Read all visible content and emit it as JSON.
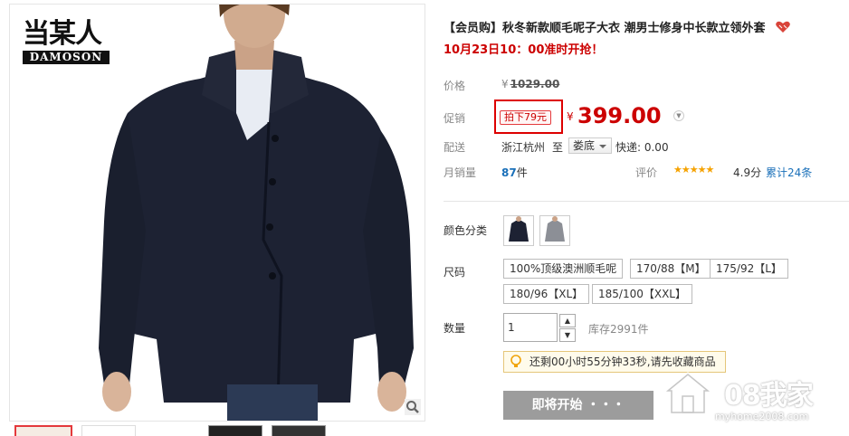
{
  "brand": {
    "logo_cn": "当某人",
    "logo_en": "DAMOSON"
  },
  "product": {
    "title": "【会员购】秋冬新款顺毛呢子大衣 潮男士修身中长款立领外套",
    "promo_time": "10月23日10：00准时开抢！"
  },
  "price": {
    "orig_label": "价格",
    "currency": "¥",
    "orig_value": "1029.00",
    "promo_label": "促销",
    "promo_tag": "拍下79元",
    "promo_value": "399.00"
  },
  "shipping": {
    "label": "配送",
    "from": "浙江杭州",
    "to_word": "至",
    "destination": "娄底",
    "fee": "快递: 0.00"
  },
  "sales": {
    "label": "月销量",
    "count": "87",
    "unit": "件",
    "rating_label": "评价",
    "stars": "★★★★★",
    "score": "4.9分",
    "review_count": "累计24条"
  },
  "options": {
    "color_label": "颜色分类",
    "size_label": "尺码",
    "sizes": [
      "100%顶级澳洲顺毛呢",
      "170/88【M】",
      "175/92【L】",
      "180/96【XL】",
      "185/100【XXL】"
    ],
    "qty_label": "数量",
    "qty_value": "1",
    "stock": "库存2991件"
  },
  "tip": "还剩00小时55分钟33秒,请先收藏商品",
  "start_button": "即将开始 ・・・",
  "watermark": {
    "text": "08我家",
    "url": "myhome2008.com"
  },
  "colors": {
    "price_red": "#cc0000",
    "link_blue": "#1a70b9",
    "button_gray": "#9c9c9c"
  }
}
